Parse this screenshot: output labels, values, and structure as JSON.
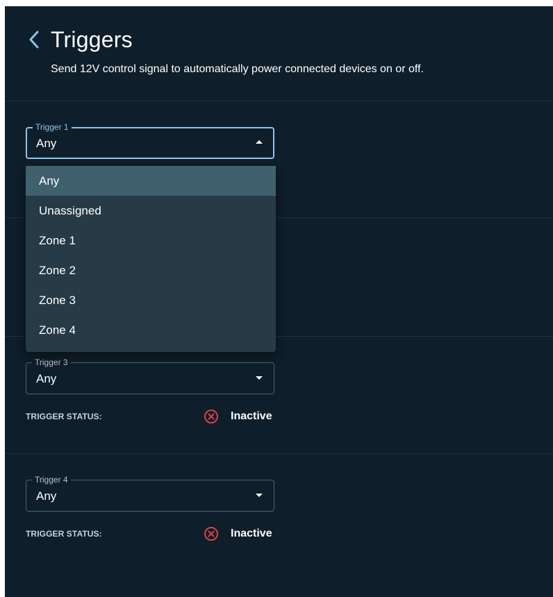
{
  "header": {
    "title": "Triggers",
    "subtitle": "Send 12V control signal to automatically power connected devices on or off."
  },
  "triggers": [
    {
      "label": "Trigger 1",
      "value": "Any"
    },
    {
      "label": "Trigger 3",
      "value": "Any",
      "status_label": "TRIGGER STATUS:",
      "status": "Inactive"
    },
    {
      "label": "Trigger 4",
      "value": "Any",
      "status_label": "TRIGGER STATUS:",
      "status": "Inactive"
    }
  ],
  "dropdown": {
    "options": [
      "Any",
      "Unassigned",
      "Zone 1",
      "Zone 2",
      "Zone 3",
      "Zone 4"
    ],
    "selected": "Any"
  },
  "colors": {
    "background": "#0e1e2a",
    "accent": "#8ec5ea",
    "inactive": "#e0404a",
    "menu_bg": "#263b46",
    "menu_selected": "#41606e"
  },
  "icons": {
    "back": "chevron-left-icon",
    "dropdown": "caret-icon",
    "status": "x-circle-icon"
  }
}
